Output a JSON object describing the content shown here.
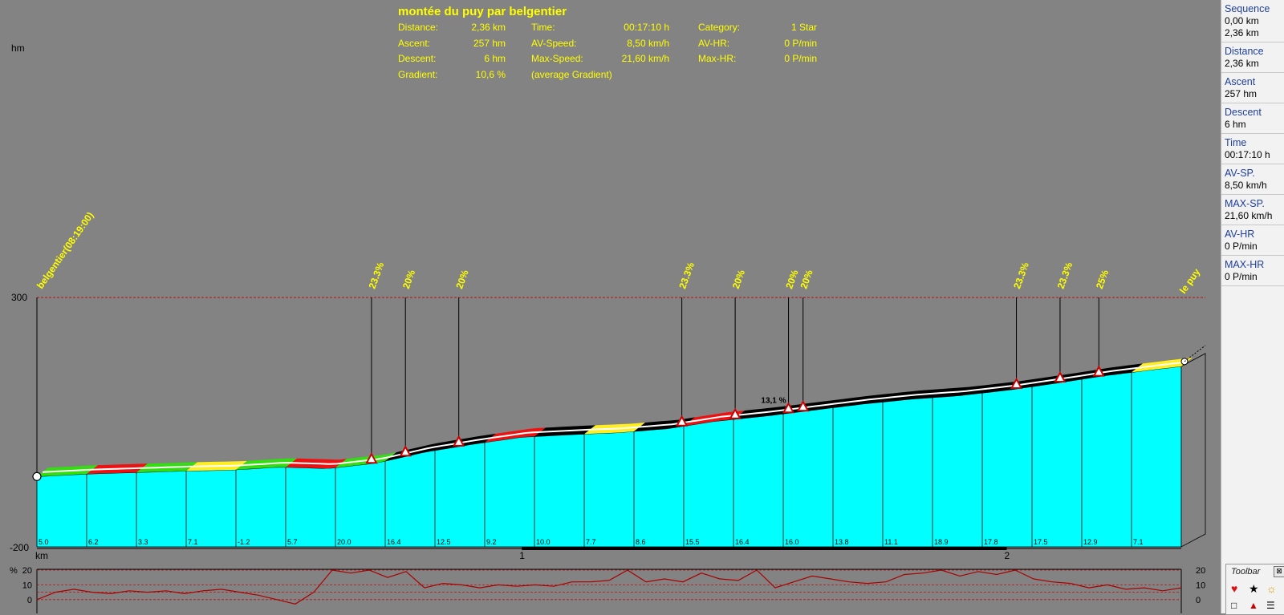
{
  "chart_data": {
    "type": "area",
    "title": "montée du puy par belgentier",
    "stats": {
      "distance_label": "Distance:",
      "distance": "2,36 km",
      "ascent_label": "Ascent:",
      "ascent": "257 hm",
      "descent_label": "Descent:",
      "descent": "6 hm",
      "gradient_label": "Gradient:",
      "gradient": "10,6 %",
      "time_label": "Time:",
      "time": "00:17:10 h",
      "avspeed_label": "AV-Speed:",
      "avspeed": "8,50 km/h",
      "maxspeed_label": "Max-Speed:",
      "maxspeed": "21,60 km/h",
      "avg_gradient_note": "(average Gradient)",
      "category_label": "Category:",
      "category": "1 Star",
      "avhr_label": "AV-HR:",
      "avhr": "0 P/min",
      "maxhr_label": "Max-HR:",
      "maxhr": "0 P/min"
    },
    "ylabel": "hm",
    "xlabel": "km",
    "ylim": [
      -200,
      300
    ],
    "xlim": [
      0,
      2.36
    ],
    "y_ticks": [
      "300",
      "-200"
    ],
    "x_ticks": [
      {
        "x": 1,
        "label": "1"
      },
      {
        "x": 2,
        "label": "2"
      }
    ],
    "grid": false,
    "profile": {
      "x": [
        0,
        0.1,
        0.2,
        0.3,
        0.4,
        0.5,
        0.6,
        0.7,
        0.8,
        0.9,
        1.0,
        1.1,
        1.2,
        1.3,
        1.4,
        1.5,
        1.6,
        1.7,
        1.8,
        1.9,
        2.0,
        2.1,
        2.2,
        2.3,
        2.36
      ],
      "y": [
        -59,
        -54,
        -51,
        -48,
        -46,
        -40,
        -43,
        -32,
        -10,
        6,
        20,
        25,
        29,
        37,
        52,
        62,
        74,
        86,
        96,
        103,
        114,
        128,
        143,
        155,
        162
      ]
    },
    "segment_gradients": [
      "5.0",
      "6.2",
      "3.3",
      "7.1",
      "-1.2",
      "5.7",
      "20.0",
      "16.4",
      "12.5",
      "9.2",
      "10.0",
      "7.7",
      "8.6",
      "15.5",
      "16.4",
      "16.0",
      "13.8",
      "11.1",
      "18.9",
      "17.8",
      "17.5",
      "12.9",
      "7.1"
    ],
    "segment_colors": [
      "green",
      "red",
      "green",
      "yellow",
      "green",
      "red",
      "green",
      "black",
      "black",
      "red",
      "black",
      "yellow",
      "black",
      "red",
      "black",
      "black",
      "black",
      "black",
      "black",
      "black",
      "black",
      "black",
      "yellow"
    ],
    "steep_markers": [
      {
        "x": 0.69,
        "label": "23.3%"
      },
      {
        "x": 0.76,
        "label": "20%"
      },
      {
        "x": 0.87,
        "label": "20%"
      },
      {
        "x": 1.33,
        "label": "23.3%"
      },
      {
        "x": 1.44,
        "label": "20%"
      },
      {
        "x": 1.55,
        "label": "20%"
      },
      {
        "x": 1.58,
        "label": "20%"
      },
      {
        "x": 2.02,
        "label": "23.3%"
      },
      {
        "x": 2.11,
        "label": "23.3%"
      },
      {
        "x": 2.19,
        "label": "25%"
      }
    ],
    "waypoints": [
      {
        "x": 0,
        "label": "belgentier(08:19:00)"
      },
      {
        "x": 2.36,
        "label": "le puy"
      }
    ],
    "annotation": {
      "x": 1.51,
      "label": "13,1 %"
    },
    "gradient_subchart": {
      "ylim": [
        -5,
        20
      ],
      "y_ticks": [
        "20",
        "10",
        "0"
      ],
      "y_label": "%",
      "values": [
        0,
        5,
        7,
        5,
        4,
        6,
        5,
        6,
        4,
        6,
        7,
        5,
        3,
        0,
        -3,
        5,
        20,
        18,
        20,
        15,
        19,
        8,
        11,
        10,
        8,
        10,
        9,
        10,
        9,
        12,
        12,
        13,
        20,
        12,
        14,
        12,
        18,
        14,
        13,
        20,
        8,
        12,
        16,
        14,
        12,
        11,
        12,
        17,
        18,
        20,
        16,
        19,
        17,
        20,
        14,
        12,
        11,
        8,
        10,
        7,
        8,
        6,
        8
      ]
    },
    "colors": {
      "fill": "#00ffff",
      "background": "#838383",
      "text": "#ffff00",
      "green": "#33dd11",
      "red": "#ee1111",
      "yellow": "#ffee22",
      "black": "#000000",
      "ref_line": "#bb1111",
      "gradient_line": "#aa0000"
    }
  },
  "sidebar": {
    "items": [
      {
        "label": "Sequence",
        "values": [
          "0,00 km",
          "2,36 km"
        ]
      },
      {
        "label": "Distance",
        "values": [
          "2,36 km"
        ]
      },
      {
        "label": "Ascent",
        "values": [
          "257 hm"
        ]
      },
      {
        "label": "Descent",
        "values": [
          "6 hm"
        ]
      },
      {
        "label": "Time",
        "values": [
          "00:17:10 h"
        ]
      },
      {
        "label": "AV-SP.",
        "values": [
          "8,50 km/h"
        ]
      },
      {
        "label": "MAX-SP.",
        "values": [
          "21,60 km/h"
        ]
      },
      {
        "label": "AV-HR",
        "values": [
          "0 P/min"
        ]
      },
      {
        "label": "MAX-HR",
        "values": [
          "0 P/min"
        ]
      }
    ]
  },
  "toolbar": {
    "title": "Toolbar",
    "close": "⊠",
    "icons": [
      "heart-icon",
      "camera-icon",
      "sun-icon",
      "shirt-icon",
      "warning-icon",
      "list-icon"
    ]
  }
}
